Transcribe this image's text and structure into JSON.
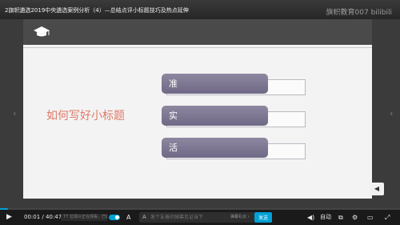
{
  "player": {
    "title": "2旗帜遴选2019中央遴选案例分析（4）—总结点评小标题技巧及热点延伸",
    "watermark": "旗帜教育007 bilibili",
    "progress_fraction": 0.02
  },
  "slide": {
    "header_icon": "graduation-cap-icon",
    "title": "如何写好小标题",
    "items": [
      {
        "label": "准"
      },
      {
        "label": "实"
      },
      {
        "label": "活"
      }
    ]
  },
  "nav": {
    "prev_glyph": "‹",
    "next_glyph": "›",
    "side_tab_glyph": "◀"
  },
  "controls": {
    "play_glyph": "▶",
    "time": "00:01 / 40:47",
    "danmaku_chip": "77 位观众正在观看，已装填 31 条弹幕",
    "danmaku_settings_glyph": "A",
    "danmaku_icon_glyph": "A",
    "danmaku_placeholder": "发个友善的弹幕见证当下",
    "etiquette": "弹幕礼仪 ›",
    "send": "发送",
    "quality": "自动",
    "volume_glyph": "◀)",
    "pip_glyph": "⧉",
    "settings_glyph": "⚙",
    "widescreen_glyph": "▭",
    "fullscreen_glyph": "⤢"
  },
  "colors": {
    "accent": "#00a1d6",
    "slide_title": "#e07a68",
    "tag_fill": "#7b7592"
  }
}
